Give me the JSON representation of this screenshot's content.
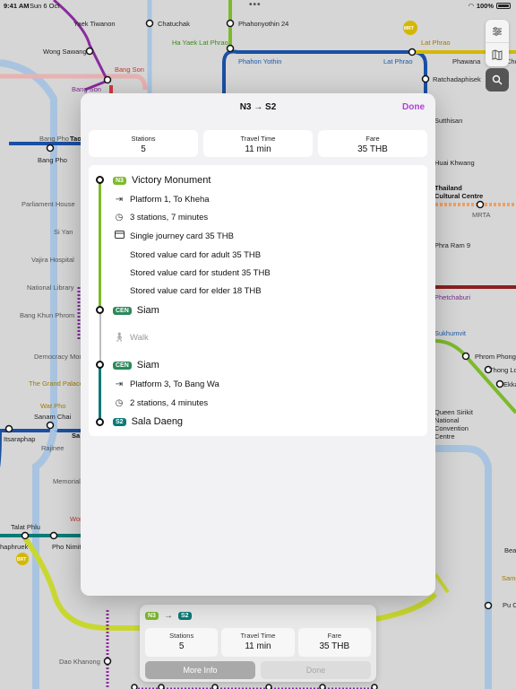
{
  "status_bar": {
    "time": "9:41 AM",
    "date": "Sun 6 Oct",
    "battery": "100%"
  },
  "map": {
    "stations": [
      {
        "id": "yaek-tiwanon",
        "name": "Yaek Tiwanon"
      },
      {
        "id": "chatuchak",
        "name": "Chatuchak"
      },
      {
        "id": "phahonyothin-24",
        "name": "Phahonyothin 24"
      },
      {
        "id": "wong-sawang",
        "name": "Wong Sawang"
      },
      {
        "id": "ha-yaek-lat-phrao",
        "name": "Ha Yaek Lat Phrao"
      },
      {
        "id": "lat-phrao-top",
        "name": "Lat Phrao"
      },
      {
        "id": "bang-son-red",
        "name": "Bang Son"
      },
      {
        "id": "bang-son-purple",
        "name": "Bang Son"
      },
      {
        "id": "phahon-yothin",
        "name": "Phahon Yothin"
      },
      {
        "id": "lat-phrao",
        "name": "Lat Phrao"
      },
      {
        "id": "phawana",
        "name": "Phawana"
      },
      {
        "id": "chok-chai",
        "name": "Chok Cha"
      },
      {
        "id": "ratchadaphisek",
        "name": "Ratchadaphisek"
      },
      {
        "id": "bang-pho-pier",
        "name": "Bang Pho"
      },
      {
        "id": "bang-pho",
        "name": "Bang Pho"
      },
      {
        "id": "tao-poon",
        "name": "Tao"
      },
      {
        "id": "sutthisan",
        "name": "Sutthisan"
      },
      {
        "id": "huai-khwang",
        "name": "Huai Khwang"
      },
      {
        "id": "parliament-house",
        "name": "Parliament House"
      },
      {
        "id": "thailand-cultural-centre",
        "name": "Thailand Cultural Centre"
      },
      {
        "id": "mrta",
        "name": "MRTA"
      },
      {
        "id": "si-yan",
        "name": "Si Yan"
      },
      {
        "id": "vajira-hospital",
        "name": "Vajira Hospital"
      },
      {
        "id": "phra-ram-9",
        "name": "Phra Ram 9"
      },
      {
        "id": "national-library",
        "name": "National Library"
      },
      {
        "id": "bang-khun-phrom",
        "name": "Bang Khun Phrom"
      },
      {
        "id": "phetchaburi",
        "name": "Phetchaburi"
      },
      {
        "id": "sukhumvit",
        "name": "Sukhumvit"
      },
      {
        "id": "democracy-monument",
        "name": "Democracy Monu"
      },
      {
        "id": "phrom-phong",
        "name": "Phrom Phong"
      },
      {
        "id": "thong-lo",
        "name": "Thong Lo"
      },
      {
        "id": "ekkamai",
        "name": "Ekka"
      },
      {
        "id": "the-grand-palace",
        "name": "The Grand Palace"
      },
      {
        "id": "wat-pho",
        "name": "Wat Pho"
      },
      {
        "id": "queen-sirikit",
        "name": "Queen Sirikit National Convention Centre"
      },
      {
        "id": "sanam-chai",
        "name": "Sanam Chai"
      },
      {
        "id": "itsaraphap",
        "name": "Itsaraphap"
      },
      {
        "id": "sam-yot",
        "name": "Sa"
      },
      {
        "id": "rajinee",
        "name": "Rajinee"
      },
      {
        "id": "memorial-bridge",
        "name": "Memorial"
      },
      {
        "id": "talat-phlu",
        "name": "Talat Phlu"
      },
      {
        "id": "wongwian-yai",
        "name": "Won"
      },
      {
        "id": "tha-phra",
        "name": "haphruek"
      },
      {
        "id": "pho-nimit",
        "name": "Pho Nimit"
      },
      {
        "id": "bearing",
        "name": "Bea"
      },
      {
        "id": "samrong",
        "name": "Samr"
      },
      {
        "id": "pu-chao",
        "name": "Pu Ch"
      },
      {
        "id": "dao-khanong",
        "name": "Dao Khanong"
      }
    ],
    "badges": {
      "mrt": "MRT",
      "brt": "BRT"
    }
  },
  "mini_card": {
    "from_badge": "N3",
    "to_badge": "S2",
    "arrow": "→",
    "stats": [
      {
        "label": "Stations",
        "value": "5"
      },
      {
        "label": "Travel Time",
        "value": "11 min"
      },
      {
        "label": "Fare",
        "value": "35 THB"
      }
    ],
    "more_info": "More Info",
    "done": "Done"
  },
  "sheet": {
    "title": "N3 → S2",
    "done": "Done",
    "summary": [
      {
        "label": "Stations",
        "value": "5"
      },
      {
        "label": "Travel Time",
        "value": "11 min"
      },
      {
        "label": "Fare",
        "value": "35 THB"
      }
    ],
    "steps": {
      "origin": {
        "badge": "N3",
        "name": "Victory Monument"
      },
      "platform1": "Platform 1, To Kheha",
      "duration1": "3 stations, 7 minutes",
      "fare_single": "Single journey card 35 THB",
      "fare_adult": "Stored value card for adult 35 THB",
      "fare_student": "Stored value card for student 35 THB",
      "fare_elder": "Stored value card for elder 18 THB",
      "transfer_arrive": {
        "badge": "CEN",
        "name": "Siam"
      },
      "walk": "Walk",
      "transfer_depart": {
        "badge": "CEN",
        "name": "Siam"
      },
      "platform2": "Platform 3, To Bang Wa",
      "duration2": "2 stations, 4 minutes",
      "destination": {
        "badge": "S2",
        "name": "Sala Daeng"
      }
    }
  },
  "colors": {
    "sukhumvit_line": "#7cba2c",
    "silom_line": "#0b7a75",
    "blue_line": "#1a4fa3",
    "purple_line": "#8a2a9e",
    "red_line": "#d23a3a",
    "gold_line": "#d4b800",
    "accent": "#b040d8"
  }
}
